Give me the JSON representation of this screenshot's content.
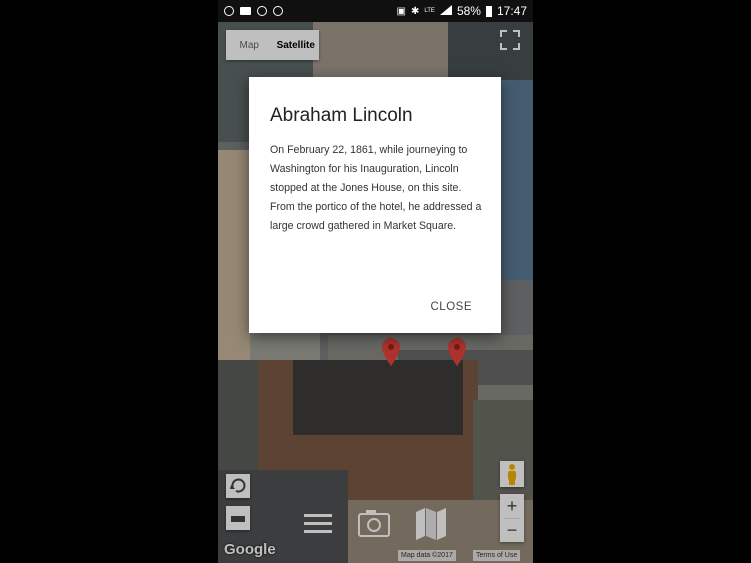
{
  "status_bar": {
    "battery": "58%",
    "time": "17:47",
    "network": "LTE"
  },
  "map_type": {
    "map_label": "Map",
    "satellite_label": "Satellite",
    "selected": "Satellite"
  },
  "dialog": {
    "title": "Abraham Lincoln",
    "body": "On February 22, 1861, while journeying to Washington for his Inauguration, Lincoln stopped at the Jones House, on this site. From the portico of the hotel, he addressed a large crowd gathered in Market Square.",
    "close_label": "CLOSE"
  },
  "map_controls": {
    "zoom_in": "+",
    "zoom_out": "−"
  },
  "attribution": {
    "logo": "Google",
    "copyright": "Map data ©2017",
    "terms": "Terms of Use"
  },
  "colors": {
    "pin": "#e8453c",
    "dialog_bg": "#ffffff",
    "pegman": "#f4b400"
  },
  "bottom_icons": [
    "menu-icon",
    "camera-icon",
    "map-icon"
  ]
}
